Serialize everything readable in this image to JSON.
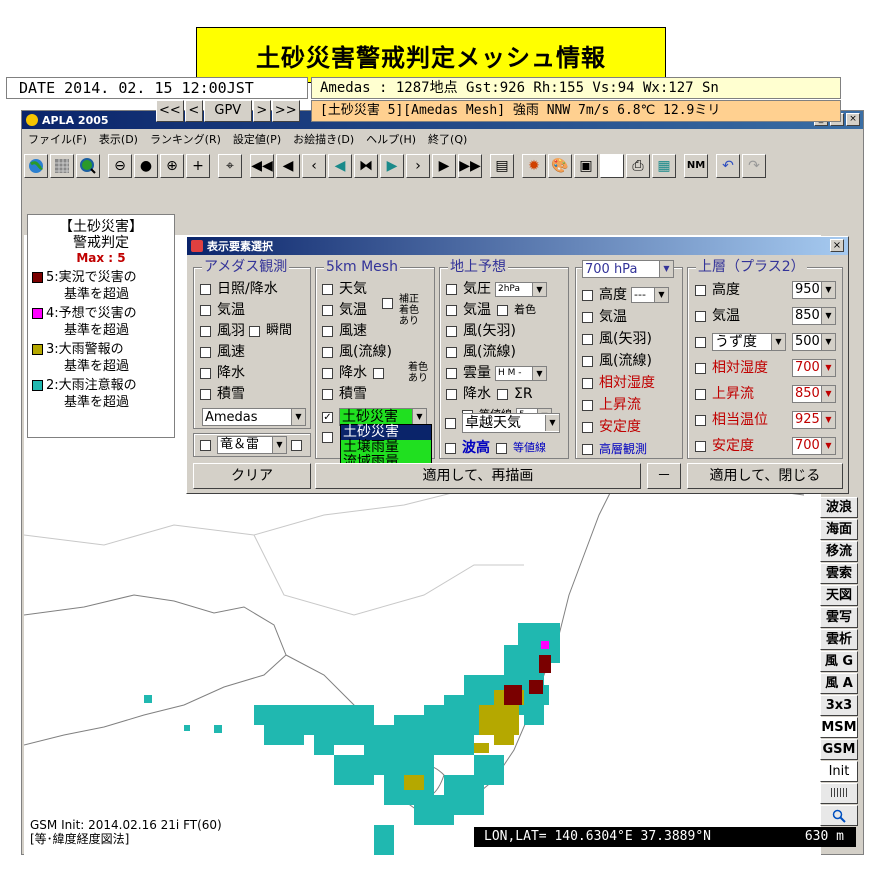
{
  "banner": {
    "title": "土砂災害警戒判定メッシュ情報"
  },
  "window": {
    "title": "APLA 2005",
    "controls": [
      "_",
      "□",
      "×"
    ],
    "menu": [
      "ファイル(F)",
      "表示(D)",
      "ランキング(R)",
      "設定値(P)",
      "お絵描き(D)",
      "ヘルプ(H)",
      "終了(Q)"
    ],
    "toolbar": {
      "icons": [
        "globe-icon",
        "grid-icon",
        "search-globe-icon",
        "zoom-out-icon",
        "minus-circle-icon",
        "plus-circle-icon",
        "plus-icon",
        "crosshair-icon",
        "first-icon",
        "prev-fast-icon",
        "prev-icon",
        "step-back-icon",
        "center-icon",
        "step-forward-icon",
        "next-icon",
        "next-fast-icon",
        "last-icon",
        "list-icon",
        "settings-icon",
        "palette-icon",
        "save-icon",
        "blank-icon",
        "print-icon",
        "image-icon",
        "nm-icon",
        "undo-icon",
        "redo-icon"
      ],
      "nm_label": "NM"
    }
  },
  "status": {
    "date": "DATE 2014. 02. 15  12:00JST",
    "amedas": "Amedas : 1287地点  Gst:926 Rh:155 Vs:94 Wx:127 Sn",
    "warning": "[土砂災害 5][Amedas Mesh] 強雨  NNW 7m/s  6.8℃  12.9ミリ",
    "nav": {
      "first": "<<",
      "prev": "<",
      "model": "GPV",
      "next": ">",
      "last": ">>"
    }
  },
  "legend": {
    "title1": "【土砂災害】",
    "title2": "警戒判定",
    "max": "Max : 5",
    "items": [
      {
        "line1": "5:実況で災害の",
        "line2": "基準を超過",
        "color": "#7a0000"
      },
      {
        "line1": "4:予想で災害の",
        "line2": "基準を超過",
        "color": "#ff00ff"
      },
      {
        "line1": "3:大雨警報の",
        "line2": "基準を超過",
        "color": "#b5a800"
      },
      {
        "line1": "2:大雨注意報の",
        "line2": "基準を超過",
        "color": "#20b8b0"
      }
    ]
  },
  "dialog": {
    "title": "表示要素選択",
    "close": "×",
    "amedas": {
      "title": "アメダス観測",
      "items": [
        "日照/降水",
        "気温",
        "風羽",
        "風速",
        "降水",
        "積雪"
      ],
      "instant": "瞬間",
      "select": "Amedas",
      "bottom_select": "竜＆雷"
    },
    "mesh5km": {
      "title": "5km Mesh",
      "items": [
        "天気",
        "気温",
        "風速",
        "風(流線)",
        "降水",
        "積雪"
      ],
      "note1": "補正",
      "note2": "着色",
      "note3": "あり",
      "note4": "着色",
      "note5": "あり",
      "select": "土砂災害",
      "dropdown": [
        "土砂災害",
        "土壌雨量",
        "流域雨量"
      ]
    },
    "ground": {
      "title": "地上予想",
      "items": [
        "気圧",
        "気温",
        "風(矢羽)",
        "風(流線)",
        "雲量",
        "降水"
      ],
      "pressure_sel": "2hPa",
      "color_opt": "着色",
      "cloud_sel": "H M -",
      "sigma": "ΣR",
      "isoline": "等値線",
      "isoline_sel": "5",
      "special_select": "卓越天気",
      "wave": "波高",
      "wave_iso": "等値線"
    },
    "hpa700": {
      "select": "700 hPa",
      "items": [
        "高度",
        "気温",
        "風(矢羽)",
        "風(流線)",
        "相対湿度",
        "上昇流",
        "安定度",
        "高層観測"
      ],
      "height_sel": "---"
    },
    "upper": {
      "title": "上層（プラス2）",
      "rows": [
        {
          "label": "高度",
          "value": "950"
        },
        {
          "label": "気温",
          "value": "850"
        },
        {
          "label": "うず度",
          "value": "500"
        },
        {
          "label": "相対湿度",
          "value": "700"
        },
        {
          "label": "上昇流",
          "value": "850"
        },
        {
          "label": "相当温位",
          "value": "925"
        },
        {
          "label": "安定度",
          "value": "700"
        }
      ]
    },
    "buttons": {
      "clear": "クリア",
      "apply_redraw": "適用して、再描画",
      "minus": "－",
      "apply_close": "適用して、閉じる"
    }
  },
  "side_buttons": [
    "波浪",
    "海面",
    "移流",
    "雲索",
    "天図",
    "雲写",
    "雲析",
    "風 G",
    "風 A",
    "3x3",
    "MSM",
    "GSM",
    "Init",
    "||||||",
    "search-icon"
  ],
  "footer": {
    "init": "GSM Init: 2014.02.16 21i FT(60)",
    "projection": "[等･緯度経度図法]",
    "coords": "LON,LAT= 140.6304°E  37.3889°N",
    "altitude": "630 m"
  },
  "colors": {
    "level5": "#7a0000",
    "level4": "#ff00ff",
    "level3": "#b5a800",
    "level2": "#20b8b0"
  }
}
